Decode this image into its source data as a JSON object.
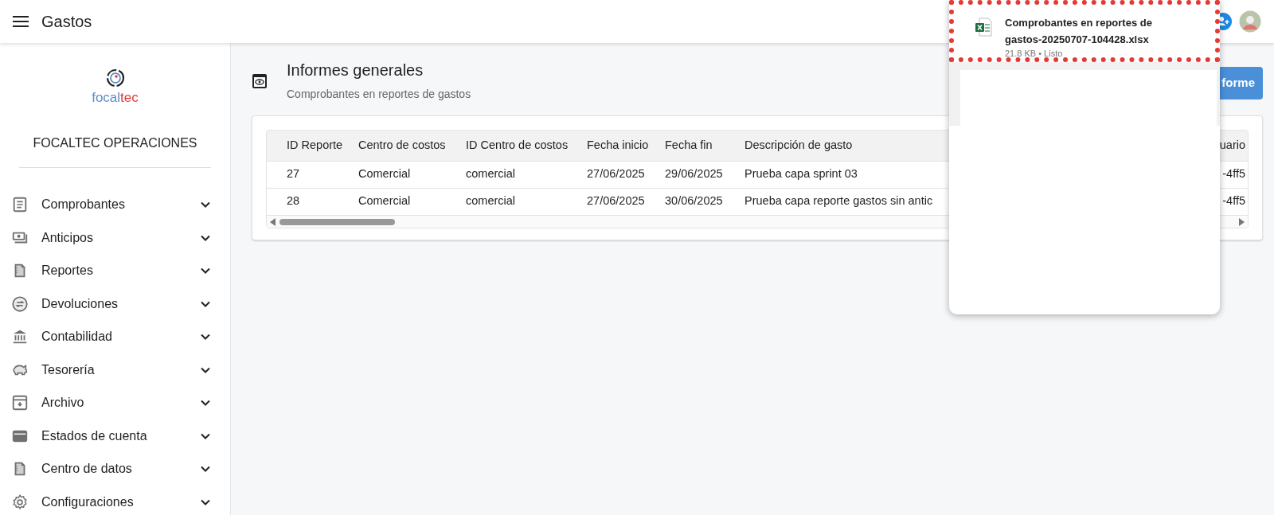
{
  "app_bar": {
    "title": "Gastos"
  },
  "sidebar": {
    "logo": {
      "parts": [
        "focal",
        "tec"
      ]
    },
    "company": "FOCALTEC OPERACIONES",
    "items": [
      {
        "label": "Comprobantes",
        "kind": "document",
        "expanded": false
      },
      {
        "label": "Anticipos",
        "kind": "cash",
        "expanded": false
      },
      {
        "label": "Reportes",
        "kind": "report",
        "expanded": false
      },
      {
        "label": "Devoluciones",
        "kind": "exchange",
        "expanded": false
      },
      {
        "label": "Contabilidad",
        "kind": "bank",
        "expanded": false
      },
      {
        "label": "Tesorería",
        "kind": "piggy",
        "expanded": false
      },
      {
        "label": "Archivo",
        "kind": "archive",
        "expanded": false
      },
      {
        "label": "Estados de cuenta",
        "kind": "wallet",
        "expanded": false
      },
      {
        "label": "Centro de datos",
        "kind": "report",
        "expanded": false
      },
      {
        "label": "Configuraciones",
        "kind": "gear",
        "expanded": false
      }
    ]
  },
  "page": {
    "title": "Informes generales",
    "subtitle": "Comprobantes en reportes de gastos",
    "button": "forme"
  },
  "table": {
    "columns": [
      "ID Reporte",
      "Centro de costos",
      "ID Centro de costos",
      "Fecha inicio",
      "Fecha fin",
      "Descripción de gasto",
      "uario"
    ],
    "rows": [
      [
        "27",
        "Comercial",
        "comercial",
        "27/06/2025",
        "29/06/2025",
        "Prueba capa sprint 03",
        "-4ff5"
      ],
      [
        "28",
        "Comercial",
        "comercial",
        "27/06/2025",
        "30/06/2025",
        "Prueba capa reporte gastos sin antic",
        "-4ff5"
      ]
    ]
  },
  "download_popup": {
    "file_name": "Comprobantes en reportes de gastos-20250707-104428.xlsx",
    "status": "21.8 KB • Listo",
    "highlighted": true
  }
}
